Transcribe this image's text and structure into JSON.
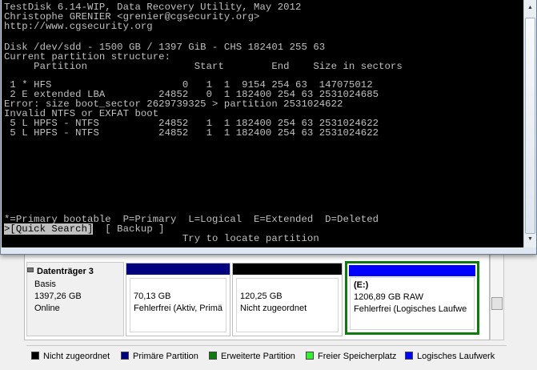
{
  "console": {
    "lines": [
      "TestDisk 6.14-WIP, Data Recovery Utility, May 2012",
      "Christophe GRENIER <grenier@cgsecurity.org>",
      "http://www.cgsecurity.org",
      "",
      "Disk /dev/sdd - 1500 GB / 1397 GiB - CHS 182401 255 63",
      "Current partition structure:",
      "     Partition                  Start        End    Size in sectors",
      "",
      " 1 * HFS                      0   1  1  9154 254 63  147075012",
      " 2 E extended LBA         24852   0  1 182400 254 63 2531024685",
      "Error: size boot_sector 2629739325 > partition 2531024622",
      "Invalid NTFS or EXFAT boot",
      " 5 L HPFS - NTFS          24852   1  1 182400 254 63 2531024622",
      " 5 L HPFS - NTFS          24852   1  1 182400 254 63 2531024622"
    ],
    "legend_line": "*=Primary bootable  P=Primary  L=Logical  E=Extended  D=Deleted",
    "menu_selected": ">[Quick Search]",
    "menu_other": "  [ Backup ]",
    "hint": "                              Try to locate partition"
  },
  "disk": {
    "name": "Datenträger 3",
    "type": "Basis",
    "size": "1397,26 GB",
    "status": "Online"
  },
  "partitions": [
    {
      "label": "",
      "size": "70,13 GB",
      "status": "Fehlerfrei (Aktiv, Primä",
      "bar_color": "#000080"
    },
    {
      "label": "",
      "size": "120,25 GB",
      "status": "Nicht zugeordnet",
      "bar_color": "#000000"
    },
    {
      "label": "(E:)",
      "size": "1206,89 GB RAW",
      "status": "Fehlerfrei (Logisches Laufwe",
      "bar_color": "#0000ff"
    }
  ],
  "legend": [
    {
      "label": "Nicht zugeordnet",
      "color": "#000000"
    },
    {
      "label": "Primäre Partition",
      "color": "#000080"
    },
    {
      "label": "Erweiterte Partition",
      "color": "#0f7a0f"
    },
    {
      "label": "Freier Speicherplatz",
      "color": "#33ee33"
    },
    {
      "label": "Logisches Laufwerk",
      "color": "#0000ff"
    }
  ]
}
